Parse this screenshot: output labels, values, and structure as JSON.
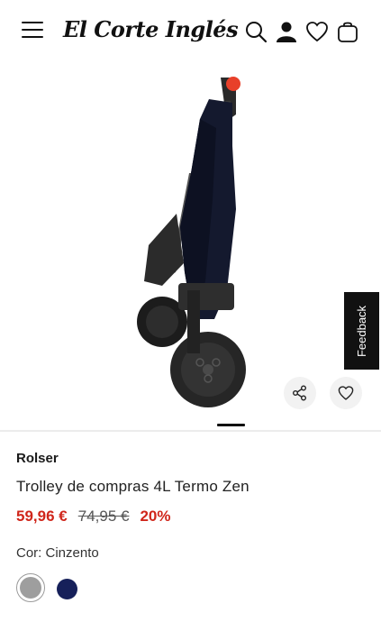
{
  "header": {
    "logo_text": "El Corte Inglés",
    "icons": [
      "menu-icon",
      "search-icon",
      "account-icon",
      "wishlist-icon",
      "bag-icon"
    ]
  },
  "gallery": {
    "slide_indicator": "1",
    "actions": [
      "share-icon",
      "heart-icon"
    ]
  },
  "feedback": {
    "label": "Feedback"
  },
  "product": {
    "brand": "Rolser",
    "title": "Trolley de compras 4L Termo Zen",
    "price_now": "59,96 €",
    "price_old": "74,95 €",
    "discount": "20%",
    "color_label": "Cor: Cinzento",
    "swatches": [
      {
        "name": "Cinzento",
        "color": "#9e9e9e",
        "selected": true
      },
      {
        "name": "Azul marinho",
        "color": "#16205a",
        "selected": false
      }
    ]
  },
  "colors": {
    "accent": "#d0261b",
    "dark": "#111111"
  }
}
